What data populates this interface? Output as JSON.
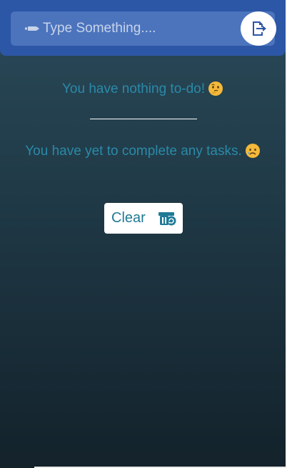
{
  "header": {
    "input": {
      "placeholder": "Type Something....",
      "value": ""
    },
    "submit_icon": "export-file-icon",
    "input_icon": "pen-icon"
  },
  "main": {
    "todo_status": "You have nothing to-do!",
    "todo_status_emoji": "thinking-face-icon",
    "completed_status": "You have yet to complete any tasks.",
    "completed_status_emoji": "sad-face-icon",
    "clear_button": {
      "label": "Clear",
      "icon": "trash-recycle-icon"
    }
  },
  "colors": {
    "header_bg": "#2c56a6",
    "input_bg": "#4c74bd",
    "status_text": "#2a8aa8",
    "button_text": "#1f7a96",
    "page_bg_top": "#2a4a5a",
    "page_bg_bottom": "#13222b"
  }
}
